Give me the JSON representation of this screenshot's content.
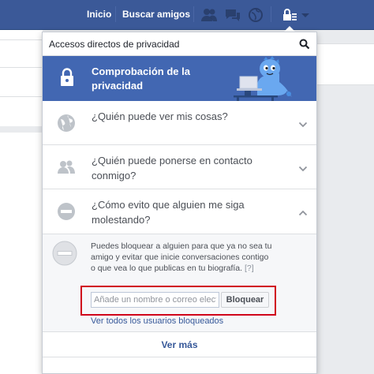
{
  "topbar": {
    "home_label": "Inicio",
    "find_friends_label": "Buscar amigos",
    "icons": [
      "friend-requests-icon",
      "messages-icon",
      "notifications-icon",
      "privacy-shortcuts-icon",
      "account-menu-icon"
    ]
  },
  "dropdown": {
    "title": "Accesos directos de privacidad",
    "banner_title": "Comprobación de la privacidad",
    "items": [
      {
        "label": "¿Quién puede ver mis cosas?",
        "icon": "globe-icon"
      },
      {
        "label": "¿Quién puede ponerse en contacto conmigo?",
        "icon": "people-icon"
      },
      {
        "label": "¿Cómo evito que alguien me siga molestando?",
        "icon": "block-icon"
      }
    ],
    "expanded": {
      "description": "Puedes bloquear a alguien para que ya no sea tu amigo y evitar que inicie conversaciones contigo o que vea lo que publicas en tu biografía.",
      "help": "[?]",
      "input_placeholder": "Añade un nombre o correo elect",
      "input_value": "",
      "block_button": "Bloquear",
      "see_all_link": "Ver todos los usuarios bloqueados"
    },
    "see_more": "Ver más"
  },
  "colors": {
    "brand_blue": "#3b5998",
    "banner_blue": "#4267b2",
    "link_blue": "#365899",
    "highlight_red": "#d0021b"
  }
}
